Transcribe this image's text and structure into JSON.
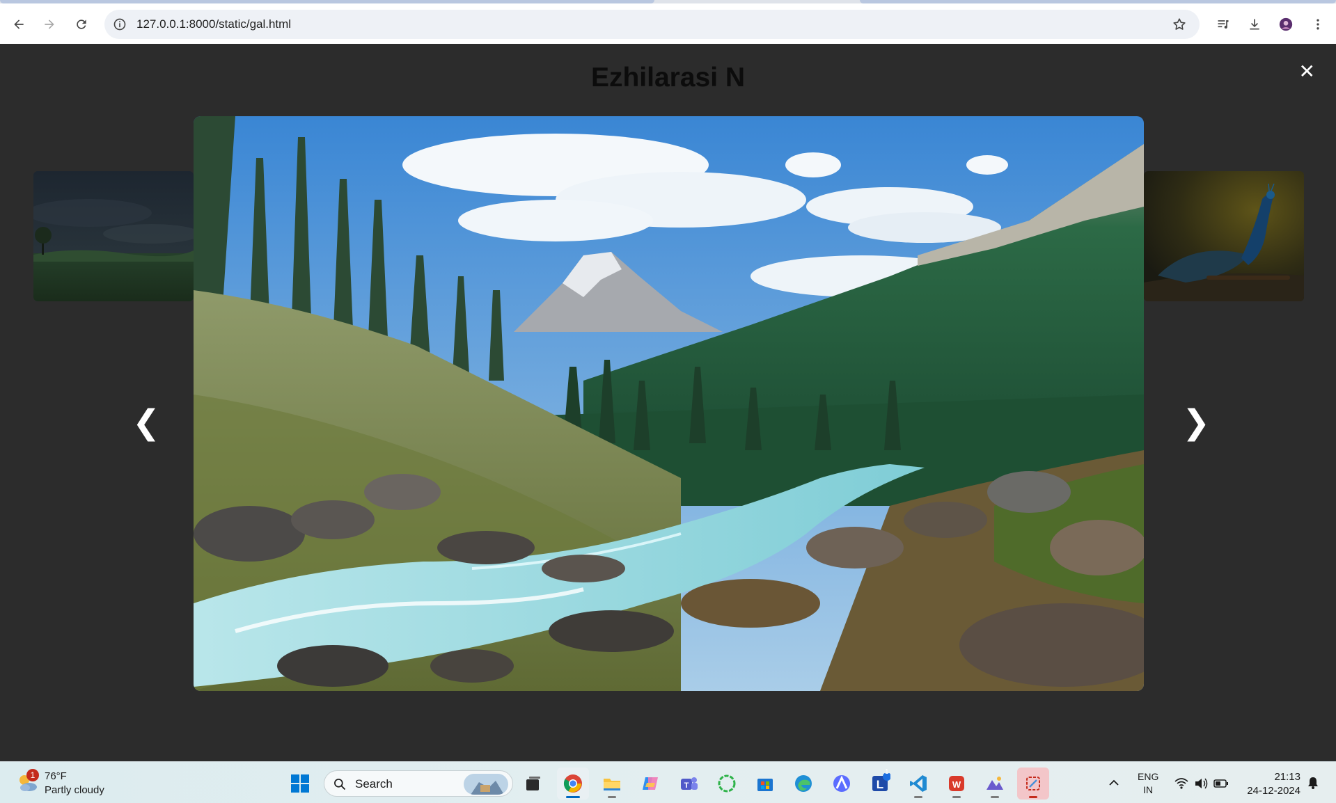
{
  "browser": {
    "url": "127.0.0.1:8000/static/gal.html",
    "icons": [
      "back-arrow-icon",
      "forward-arrow-icon",
      "reload-icon",
      "site-info-icon",
      "bookmark-star-icon",
      "media-controls-icon",
      "downloads-icon",
      "profile-avatar",
      "more-menu-icon"
    ]
  },
  "lightbox": {
    "title": "Ezhilarasi N",
    "close_symbol": "✕",
    "prev_symbol": "❮",
    "next_symbol": "❯",
    "main_image": "mountain river valley with pine forest",
    "left_thumbnail": "dusky grassland with tree",
    "right_thumbnail": "peacock on branch"
  },
  "taskbar": {
    "weather": {
      "badge": "1",
      "temp": "76°F",
      "condition": "Partly cloudy"
    },
    "search_placeholder": "Search",
    "apps": [
      "windows-start",
      "task-view",
      "chrome",
      "file-explorer",
      "copilot",
      "teams",
      "circle-app",
      "microsoft-store",
      "edge",
      "arc-app",
      "l-app",
      "vscode",
      "wps-office",
      "photos",
      "snipping-tool"
    ],
    "l_app_badge": "1",
    "language": {
      "line1": "ENG",
      "line2": "IN"
    },
    "time": "21:13",
    "date": "24-12-2024"
  },
  "colors": {
    "page_bg": "#2c2c2c",
    "title": "#0c0c0c",
    "accent": "#0067c0",
    "notification": "#c42b1c"
  }
}
